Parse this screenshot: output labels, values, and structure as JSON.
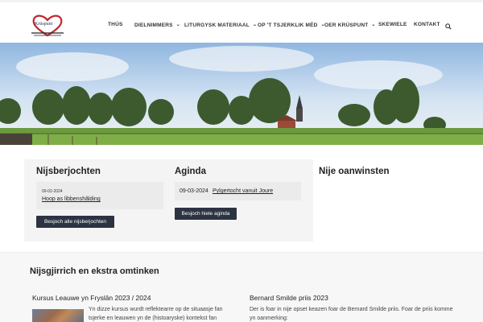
{
  "site": {
    "logo_text": "Krúspunt"
  },
  "nav": {
    "items": [
      {
        "label": "THÚS",
        "dropdown": false
      },
      {
        "label": "DIELNIMMERS",
        "dropdown": true
      },
      {
        "label": "LITURGYSK MATERIAAL",
        "dropdown": true
      },
      {
        "label": "OP 'T TSJERKLIK MÉD",
        "dropdown": true
      },
      {
        "label": "OER KRÚSPUNT",
        "dropdown": true
      },
      {
        "label": "SKEWIELE",
        "dropdown": false
      },
      {
        "label": "KONTAKT",
        "dropdown": false
      }
    ],
    "search_icon": "search-icon"
  },
  "news": {
    "title": "Nijsberjochten",
    "items": [
      {
        "date": "09-02-2024",
        "title": "Hoop as libbenshâlding"
      }
    ],
    "button": "Besjoch alle nijsberjochten"
  },
  "agenda": {
    "title": "Aginda",
    "items": [
      {
        "date": "09-03-2024",
        "title": "Pylgertocht vanuit Joure"
      }
    ],
    "button": "Besjoch hiele aginda"
  },
  "acquisitions": {
    "title": "Nije oanwinsten"
  },
  "extra": {
    "title": "Nijsgjirrich en ekstra omtinken",
    "posts": [
      {
        "title": "Kursus Leauwe yn Fryslân 2023 / 2024",
        "text_lines": [
          "Yn dizze kursus wurdt reflektearre op de situaasje fan",
          "tsjerke en leauwen yn de (histoaryske) kontekst fan"
        ]
      },
      {
        "title": "Bernard Smilde priis 2023",
        "text_lines": [
          "Der is foar in nije opset keazen foar de Bernard Smilde priis. Foar de priis komme",
          "yn oanmerking:"
        ]
      }
    ]
  },
  "colors": {
    "button_bg": "#2c3342",
    "card_bg": "#f4f4f4",
    "logo_heart": "#c0262d"
  }
}
